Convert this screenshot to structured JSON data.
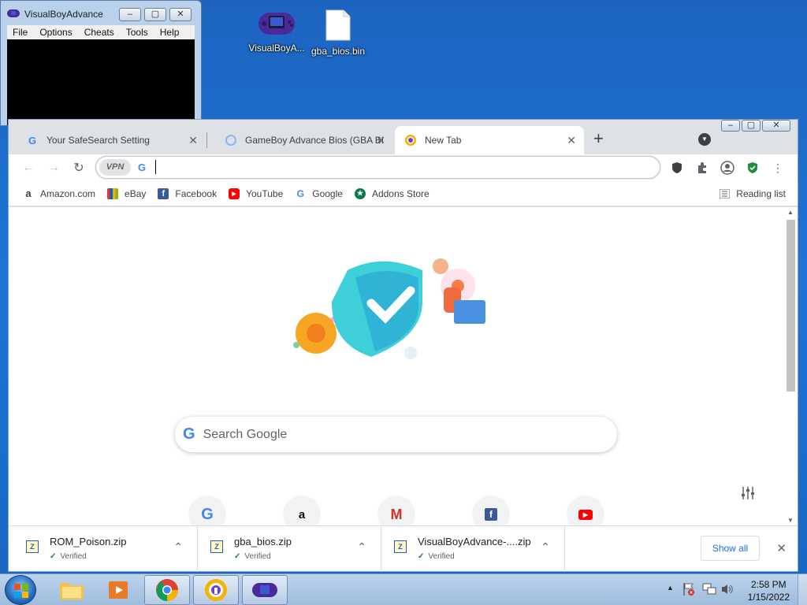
{
  "vba_window": {
    "title": "VisualBoyAdvance",
    "menu": [
      "File",
      "Options",
      "Cheats",
      "Tools",
      "Help"
    ]
  },
  "desktop_icons": [
    {
      "label": "VisualBoyA...",
      "icon": "gba-console-icon"
    },
    {
      "label": "gba_bios.bin",
      "icon": "file-icon"
    }
  ],
  "browser": {
    "tabs": [
      {
        "title": "Your SafeSearch Setting",
        "icon": "google-g-icon",
        "active": false
      },
      {
        "title": "GameBoy Advance Bios (GBA BIOS",
        "icon": "site-favicon-icon",
        "active": false
      },
      {
        "title": "New Tab",
        "icon": "browser-logo-icon",
        "active": true
      }
    ],
    "omnibox": {
      "vpn_label": "VPN",
      "value": ""
    },
    "bookmarks": [
      {
        "label": "Amazon.com",
        "icon": "amazon-icon"
      },
      {
        "label": "eBay",
        "icon": "ebay-icon"
      },
      {
        "label": "Facebook",
        "icon": "facebook-icon"
      },
      {
        "label": "YouTube",
        "icon": "youtube-icon"
      },
      {
        "label": "Google",
        "icon": "google-g-icon"
      },
      {
        "label": "Addons Store",
        "icon": "addons-store-icon"
      }
    ],
    "reading_list": "Reading list",
    "search_placeholder": "Search Google",
    "shortcuts": [
      "google",
      "amazon",
      "gmail",
      "facebook",
      "youtube"
    ],
    "downloads": [
      {
        "name": "ROM_Poison.zip",
        "status": "Verified"
      },
      {
        "name": "gba_bios.zip",
        "status": "Verified"
      },
      {
        "name": "VisualBoyAdvance-....zip",
        "status": "Verified"
      }
    ],
    "show_all": "Show all"
  },
  "taskbar": {
    "time": "2:58 PM",
    "date": "1/15/2022"
  },
  "colors": {
    "desktop": "#1f6fcc",
    "accent": "#1a73e8",
    "verified": "#188038"
  }
}
